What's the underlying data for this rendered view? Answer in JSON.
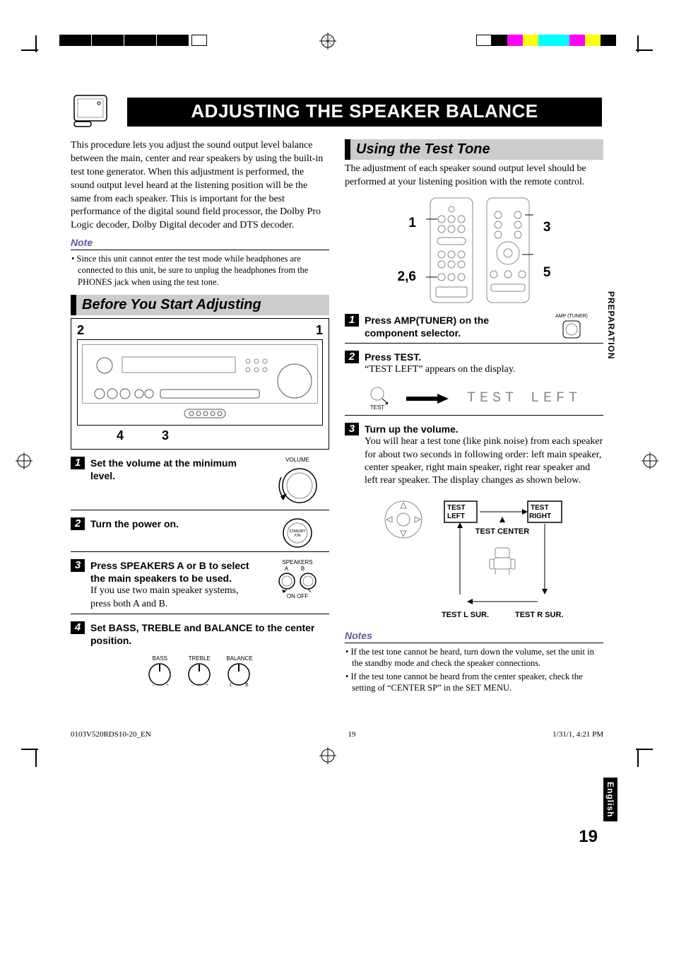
{
  "page_number": "19",
  "title": "ADJUSTING THE SPEAKER BALANCE",
  "intro": "This procedure lets you adjust the sound output level balance between the main, center and rear speakers by using the built-in test tone generator. When this adjustment is performed, the sound output level heard at the listening position will be the same from each speaker. This is important for the best performance of the digital sound field processor, the Dolby Pro Logic decoder, Dolby Digital decoder and DTS decoder.",
  "note_label": "Note",
  "note_intro": "• Since this unit cannot enter the test mode while headphones are connected to this unit, be sure to unplug the headphones from the PHONES jack when using the test tone.",
  "left_section": {
    "heading": "Before You Start Adjusting",
    "callouts": {
      "top_left": "2",
      "top_right": "1",
      "bottom_left": "4",
      "bottom_right": "3"
    },
    "steps": [
      {
        "n": "1",
        "title": "Set the volume at the minimum level.",
        "icon_label": "VOLUME"
      },
      {
        "n": "2",
        "title": "Turn the power on.",
        "icon_label": "STANDBY /ON"
      },
      {
        "n": "3",
        "title": "Press SPEAKERS A or B to select the main speakers to be used.",
        "desc": "If you use two main speaker systems, press both A and B.",
        "icon_label": "SPEAKERS",
        "icon_sub": "A       B",
        "icon_foot": "ON    OFF"
      },
      {
        "n": "4",
        "title": "Set BASS, TREBLE and BALANCE to the center position.",
        "knobs": [
          "BASS",
          "TREBLE",
          "BALANCE"
        ],
        "balance_lr": [
          "L",
          "R"
        ]
      }
    ]
  },
  "right_section": {
    "heading": "Using the Test Tone",
    "intro": "The adjustment of each speaker sound output level should be performed at your listening position with the remote control.",
    "remote_callouts": {
      "left_top": "1",
      "left_bottom": "2,6",
      "right_top": "3",
      "right_mid": "5"
    },
    "steps": [
      {
        "n": "1",
        "title": "Press AMP(TUNER) on the component selector.",
        "icon_label": "AMP (TUNER)"
      },
      {
        "n": "2",
        "title": "Press TEST.",
        "desc": "“TEST LEFT” appears on the display.",
        "display": "TEST LEFT",
        "icon_label": "TEST"
      },
      {
        "n": "3",
        "title": "Turn up the volume.",
        "desc": "You will hear a test tone (like pink noise) from each speaker for about two seconds in following order: left main speaker, center speaker, right main speaker, right rear speaker and left rear speaker. The display changes as shown below.",
        "grid": {
          "tl": "TEST LEFT",
          "tr": "TEST RIGHT",
          "tc": "TEST CENTER",
          "bl": "TEST L SUR.",
          "br": "TEST R SUR."
        }
      }
    ],
    "notes_label": "Notes",
    "notes": [
      "• If the test tone cannot be heard, turn down the volume, set the unit in the standby mode and check the speaker connections.",
      "• If the test tone cannot be heard from the center speaker, check the setting of “CENTER SP” in the SET MENU."
    ]
  },
  "sidebar": {
    "section": "PREPARATION",
    "language": "English"
  },
  "footer": {
    "file": "0103V520RDS10-20_EN",
    "pg": "19",
    "date": "1/31/1, 4:21 PM"
  }
}
